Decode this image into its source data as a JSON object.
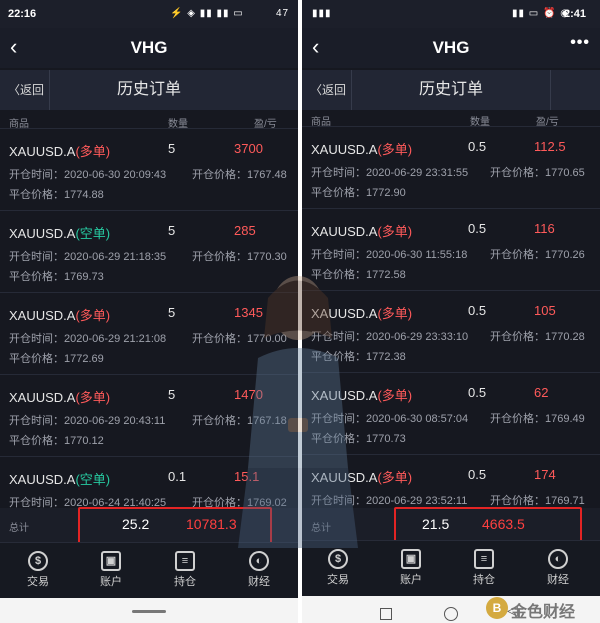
{
  "left": {
    "status": {
      "time": "22:16",
      "icons": "⚡ ◈ ▮▮ ▮▮ ▭",
      "battery": "47"
    },
    "header": {
      "title": "VHG"
    },
    "sub_header": {
      "back_label": "〈返回",
      "title": "历史订单"
    },
    "columns": {
      "product": "商品",
      "quantity": "数量",
      "pl": "盈/亏"
    },
    "orders": [
      {
        "symbol": "XAUUSD.A",
        "direction": "(多单)",
        "quantity": "5",
        "pl": "3700",
        "open_time": "开仓时间：2020-06-30 20:09:43",
        "open_price": "开仓价格：1767.48",
        "close_price": "平仓价格：1774.88"
      },
      {
        "symbol": "XAUUSD.A",
        "direction": "(空单)",
        "quantity": "5",
        "pl": "285",
        "open_time": "开仓时间：2020-06-29 21:18:35",
        "open_price": "开仓价格：1770.30",
        "close_price": "平仓价格：1769.73"
      },
      {
        "symbol": "XAUUSD.A",
        "direction": "(多单)",
        "quantity": "5",
        "pl": "1345",
        "open_time": "开仓时间：2020-06-29 21:21:08",
        "open_price": "开仓价格：1770.00",
        "close_price": "平仓价格：1772.69"
      },
      {
        "symbol": "XAUUSD.A",
        "direction": "(多单)",
        "quantity": "5",
        "pl": "1470",
        "open_time": "开仓时间：2020-06-29 20:43:11",
        "open_price": "开仓价格：1767.18",
        "close_price": "平仓价格：1770.12"
      },
      {
        "symbol": "XAUUSD.A",
        "direction": "(空单)",
        "quantity": "0.1",
        "pl": "15.1",
        "open_time": "开仓时间：2020-06-24 21:40:25",
        "open_price": "开仓价格：1769.02",
        "close_price": ""
      }
    ],
    "total": {
      "label": "总计",
      "quantity": "25.2",
      "pl": "10781.3"
    },
    "tabs": [
      {
        "label": "交易",
        "icon": "dollar-icon",
        "glyph": "$"
      },
      {
        "label": "账户",
        "icon": "account-icon",
        "glyph": "▣"
      },
      {
        "label": "持仓",
        "icon": "document-icon",
        "glyph": "≡"
      },
      {
        "label": "财经",
        "icon": "globe-icon",
        "glyph": "◐"
      }
    ]
  },
  "right": {
    "status": {
      "time": "2:41",
      "icons": "▮▮ ▭ ⏰ ◉"
    },
    "header": {
      "title": "VHG",
      "more": "•••"
    },
    "sub_header": {
      "back_label": "〈返回",
      "title": "历史订单"
    },
    "columns": {
      "product": "商品",
      "quantity": "数量",
      "pl": "盈/亏"
    },
    "orders": [
      {
        "symbol": "XAUUSD.A",
        "direction": "(多单)",
        "quantity": "0.5",
        "pl": "112.5",
        "open_time": "开仓时间：2020-06-29 23:31:55",
        "open_price": "开仓价格：1770.65",
        "close_price": "平仓价格：1772.90"
      },
      {
        "symbol": "XAUUSD.A",
        "direction": "(多单)",
        "quantity": "0.5",
        "pl": "116",
        "open_time": "开仓时间：2020-06-30 11:55:18",
        "open_price": "开仓价格：1770.26",
        "close_price": "平仓价格：1772.58"
      },
      {
        "symbol": "XAUUSD.A",
        "direction": "(多单)",
        "quantity": "0.5",
        "pl": "105",
        "open_time": "开仓时间：2020-06-29 23:33:10",
        "open_price": "开仓价格：1770.28",
        "close_price": "平仓价格：1772.38"
      },
      {
        "symbol": "XAUUSD.A",
        "direction": "(多单)",
        "quantity": "0.5",
        "pl": "62",
        "open_time": "开仓时间：2020-06-30 08:57:04",
        "open_price": "开仓价格：1769.49",
        "close_price": "平仓价格：1770.73"
      },
      {
        "symbol": "XAUUSD.A",
        "direction": "(多单)",
        "quantity": "0.5",
        "pl": "174",
        "open_time": "开仓时间：2020-06-29 23:52:11",
        "open_price": "开仓价格：1769.71",
        "close_price": ""
      }
    ],
    "total": {
      "label": "总计",
      "quantity": "21.5",
      "pl": "4663.5"
    },
    "tabs": [
      {
        "label": "交易",
        "icon": "dollar-icon",
        "glyph": "$"
      },
      {
        "label": "账户",
        "icon": "account-icon",
        "glyph": "▣"
      },
      {
        "label": "持仓",
        "icon": "document-icon",
        "glyph": "≡"
      },
      {
        "label": "财经",
        "icon": "globe-icon",
        "glyph": "◐"
      }
    ]
  },
  "watermark": {
    "text": "金色财经",
    "logo": "B"
  },
  "colors": {
    "background": "#161820",
    "loss_profit": "#ff5a5a",
    "short": "#27c9a0",
    "highlight_box": "#e32424"
  }
}
